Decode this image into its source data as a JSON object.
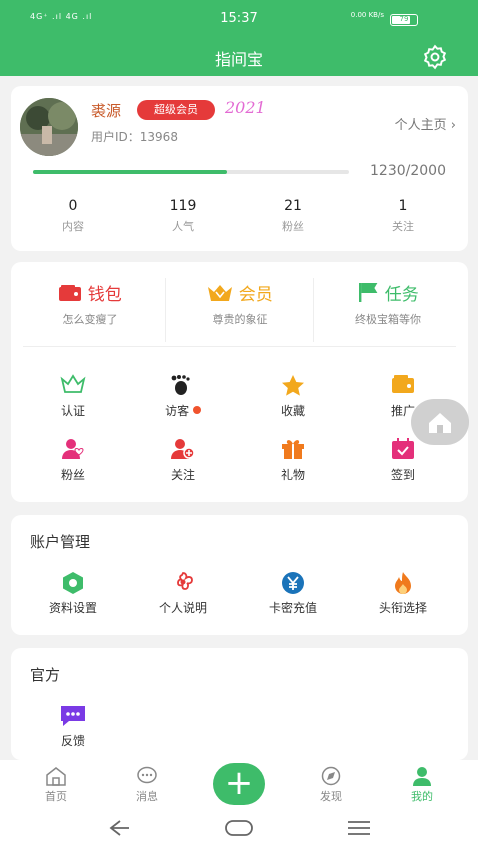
{
  "status": {
    "signal": "4G⁺ .ıl 4G .ıl",
    "time": "15:37",
    "speed": "0.00\nKB/s",
    "battery": "79"
  },
  "header": {
    "title": "指间宝"
  },
  "profile": {
    "name": "裘源",
    "vip": "超级会员",
    "year": "2021",
    "uid": "用户ID：13968",
    "homepage": "个人主页 ›",
    "progress": 0.615,
    "progress_text": "1230/2000"
  },
  "stats": [
    {
      "value": "0",
      "label": "内容"
    },
    {
      "value": "119",
      "label": "人气"
    },
    {
      "value": "21",
      "label": "粉丝"
    },
    {
      "value": "1",
      "label": "关注"
    }
  ],
  "features": [
    {
      "title": "钱包",
      "sub": "怎么变瘦了",
      "color": "#e53a3a"
    },
    {
      "title": "会员",
      "sub": "尊贵的象征",
      "color": "#f2a81d"
    },
    {
      "title": "任务",
      "sub": "终极宝箱等你",
      "color": "#3ebc6a"
    }
  ],
  "grid": [
    {
      "label": "认证",
      "icon": "crown-icon",
      "color": "#3ebc6a"
    },
    {
      "label": "访客",
      "icon": "footprint-icon",
      "color": "#222"
    },
    {
      "label": "收藏",
      "icon": "star-icon",
      "color": "#f2a81d"
    },
    {
      "label": "推广",
      "icon": "wallet-icon",
      "color": "#f2a81d"
    },
    {
      "label": "粉丝",
      "icon": "user-heart-icon",
      "color": "#e4307a"
    },
    {
      "label": "关注",
      "icon": "user-add-icon",
      "color": "#e53a3a"
    },
    {
      "label": "礼物",
      "icon": "gift-icon",
      "color": "#f07a1d"
    },
    {
      "label": "签到",
      "icon": "calendar-icon",
      "color": "#e4307a"
    }
  ],
  "account": {
    "title": "账户管理",
    "items": [
      {
        "label": "资料设置",
        "icon": "hexagon-icon",
        "color": "#3ebc6a"
      },
      {
        "label": "个人说明",
        "icon": "flower-icon",
        "color": "#e53a3a"
      },
      {
        "label": "卡密充值",
        "icon": "yen-icon",
        "color": "#1a73b9"
      },
      {
        "label": "头衔选择",
        "icon": "fire-icon",
        "color": "#f07a1d"
      }
    ]
  },
  "official": {
    "title": "官方",
    "items": [
      {
        "label": "反馈",
        "icon": "chat-icon",
        "color": "#7a3ae5"
      }
    ]
  },
  "tabs": [
    {
      "label": "首页",
      "icon": "home-icon"
    },
    {
      "label": "消息",
      "icon": "message-icon"
    },
    {
      "label": "发现",
      "icon": "compass-icon"
    },
    {
      "label": "我的",
      "icon": "user-icon",
      "active": true
    }
  ]
}
